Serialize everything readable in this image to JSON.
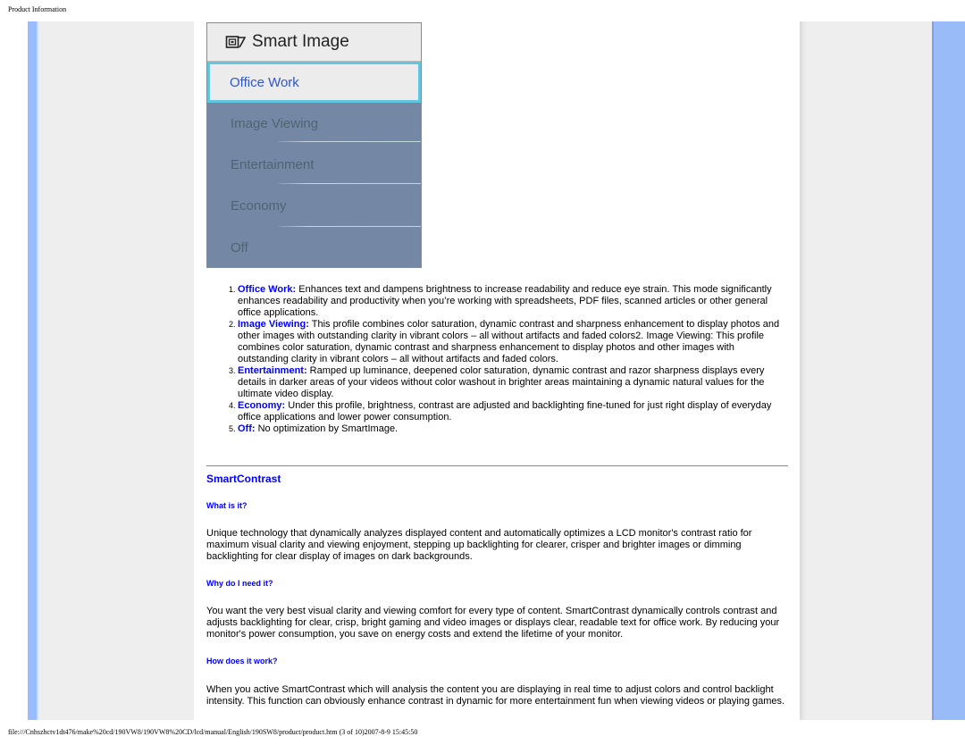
{
  "header": {
    "title": "Product Information"
  },
  "osd_menu": {
    "title": "Smart Image",
    "title_icon": "smartimage-icon",
    "items": [
      {
        "label": "Office Work",
        "selected": true
      },
      {
        "label": "Image Viewing",
        "selected": false
      },
      {
        "label": "Entertainment",
        "selected": false
      },
      {
        "label": "Economy",
        "selected": false
      },
      {
        "label": "Off",
        "selected": false
      }
    ]
  },
  "modes": [
    {
      "number": "1.",
      "term": "Office Work:",
      "text": " Enhances text and dampens brightness to increase readability and reduce eye strain. This mode significantly enhances readability and productivity when you’re working with spreadsheets, PDF files, scanned articles or other general office applications."
    },
    {
      "number": "2.",
      "term": "Image Viewing:",
      "text": " This profile combines color saturation, dynamic contrast and sharpness enhancement to display photos and other images with outstanding clarity in vibrant colors – all without artifacts and faded colors2. Image Viewing: This profile combines color saturation, dynamic contrast and sharpness enhancement to display photos and other images with outstanding clarity in vibrant colors – all without artifacts and faded colors."
    },
    {
      "number": "3.",
      "term": "Entertainment:",
      "text": " Ramped up luminance, deepened color saturation, dynamic contrast and razor sharpness displays every details in darker areas of your videos without color washout in brighter areas maintaining a dynamic natural values for the ultimate video display."
    },
    {
      "number": "4.",
      "term": "Economy:",
      "text": " Under this profile, brightness, contrast are adjusted and backlighting fine-tuned for just right display of everyday office applications and lower power consumption."
    },
    {
      "number": "5.",
      "term": "Off:",
      "text": " No optimization by SmartImage."
    }
  ],
  "smartcontrast": {
    "heading": "SmartContrast",
    "sections": [
      {
        "question": "What is it?",
        "answer": "Unique technology that dynamically analyzes displayed content and automatically optimizes a LCD monitor's contrast ratio for maximum visual clarity and viewing enjoyment, stepping up backlighting for clearer, crisper and brighter images or dimming backlighting for clear display of images on dark backgrounds."
      },
      {
        "question": "Why do I need it?",
        "answer": "You want the very best visual clarity and viewing comfort for every type of content. SmartContrast dynamically controls contrast and adjusts backlighting for clear, crisp, bright gaming and video images or displays clear, readable text for office work. By reducing your monitor's power consumption, you save on energy costs and extend the lifetime of your monitor."
      },
      {
        "question": "How does it work?",
        "answer": "When you active SmartContrast which will analysis the content you are displaying in real time to adjust colors and control backlight intensity. This function can obviously enhance contrast in dynamic for more entertainment fun when viewing videos or playing games."
      }
    ]
  },
  "footer": {
    "text": "file:///Cnhszhctv1dt476/make%20cd/190VW8/190VW8%20CD/lcd/manual/English/190SW8/product/product.htm (3 of 10)2007-8-9 15:45:50"
  },
  "colors": {
    "link_blue": "#0000ff",
    "side_bar_blue": "#99bbff",
    "osd_bg": "#7488a5",
    "osd_highlight_border": "#62c6e0"
  }
}
